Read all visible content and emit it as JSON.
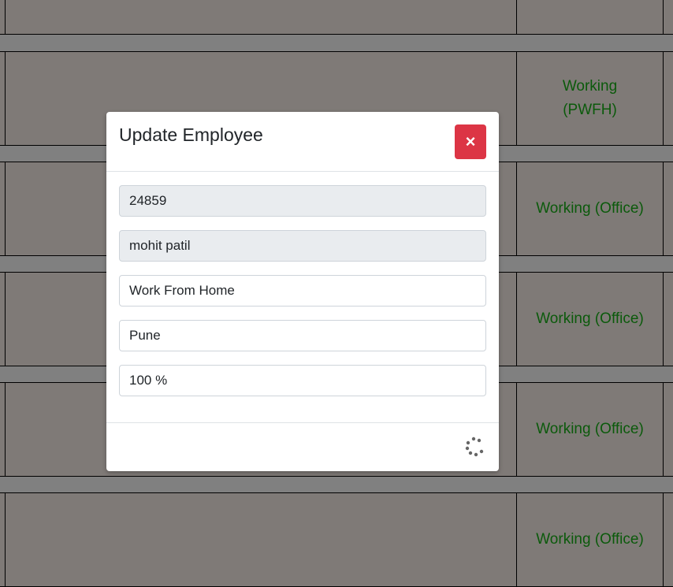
{
  "rows": [
    {
      "status": ""
    },
    {
      "status": "Working (PWFH)"
    },
    {
      "status": "Working (Office)"
    },
    {
      "status": "Working (Office)"
    },
    {
      "status": "Working (Office)"
    },
    {
      "status": "Working (Office)"
    }
  ],
  "modal": {
    "title": "Update Employee",
    "close_label": "×",
    "fields": {
      "employee_id": "24859",
      "name": "mohit patil",
      "work_mode": "Work From Home",
      "location": "Pune",
      "percentage": "100 %"
    },
    "loading_icon": "spinner-icon"
  },
  "colors": {
    "status_text": "#0b5a0b",
    "close_button": "#dc3545"
  }
}
